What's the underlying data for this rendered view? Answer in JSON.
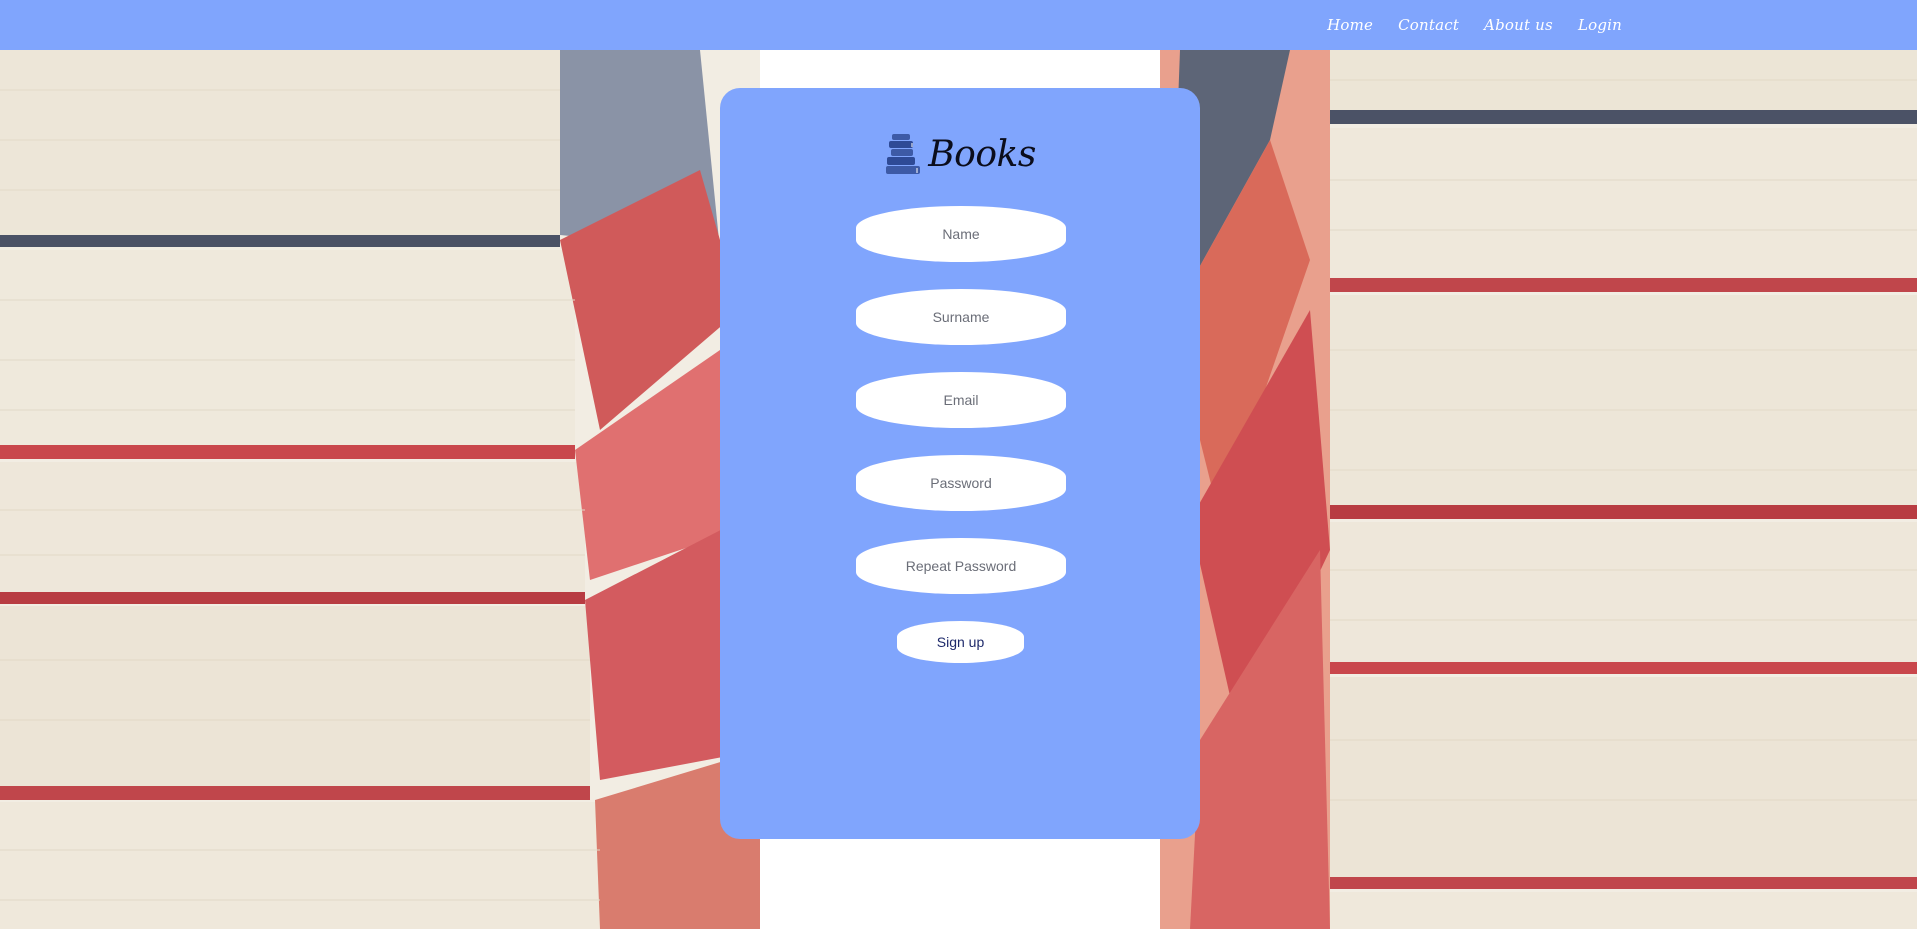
{
  "nav": {
    "links": [
      "Home",
      "Contact",
      "About us",
      "Login"
    ]
  },
  "brand": {
    "name": "Books",
    "icon": "book-stack-icon"
  },
  "form": {
    "name_placeholder": "Name",
    "surname_placeholder": "Surname",
    "email_placeholder": "Email",
    "password_placeholder": "Password",
    "repeat_password_placeholder": "Repeat Password",
    "submit_label": "Sign up"
  },
  "colors": {
    "accent": "#80a5fd",
    "page_background": "#ffffff",
    "button_text": "#1e2a6b"
  }
}
